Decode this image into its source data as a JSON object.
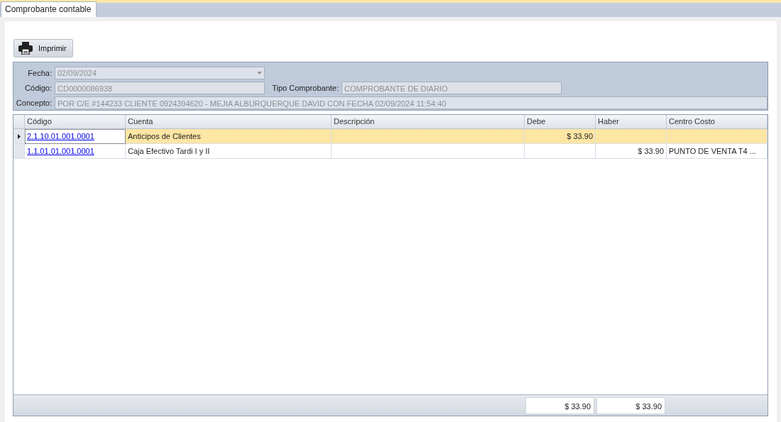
{
  "tab": {
    "label": "Comprobante contable",
    "selected": true
  },
  "toolbar": {
    "print_button": "Imprimir"
  },
  "form": {
    "fecha": {
      "label": "Fecha:",
      "value": "02/09/2024",
      "disabled": true
    },
    "codigo": {
      "label": "Código:",
      "value": "CD0000086938",
      "disabled": true
    },
    "tipo": {
      "label": "Tipo Comprobante:",
      "value": "COMPROBANTE DE DIARIO",
      "disabled": true
    },
    "concepto": {
      "label": "Concepto:",
      "value": "POR C/E #144233 CLIENTE 0924394620 - MEJIA ALBURQUERQUE DAVID CON FECHA 02/09/2024 11:54:40",
      "disabled": true
    }
  },
  "table": {
    "columns": [
      "Código",
      "Cuenta",
      "Descripción",
      "Debe",
      "Haber",
      "Centro Costo"
    ],
    "rows": [
      {
        "selected": true,
        "codigo": "2.1.10.01.001.0001",
        "cuenta": "Anticipos de Clientes",
        "debe": "$ 33.90",
        "haber": "",
        "centro_costo": ""
      },
      {
        "selected": false,
        "codigo": "1.1.01.01.001.0001",
        "cuenta": "Caja Efectivo Tardi I y II",
        "debe": "",
        "haber": "$ 33.90",
        "centro_costo": "PUNTO DE VENTA T4 ..."
      }
    ],
    "totals": {
      "debe": "$ 33.90",
      "haber": "$ 33.90"
    }
  }
}
